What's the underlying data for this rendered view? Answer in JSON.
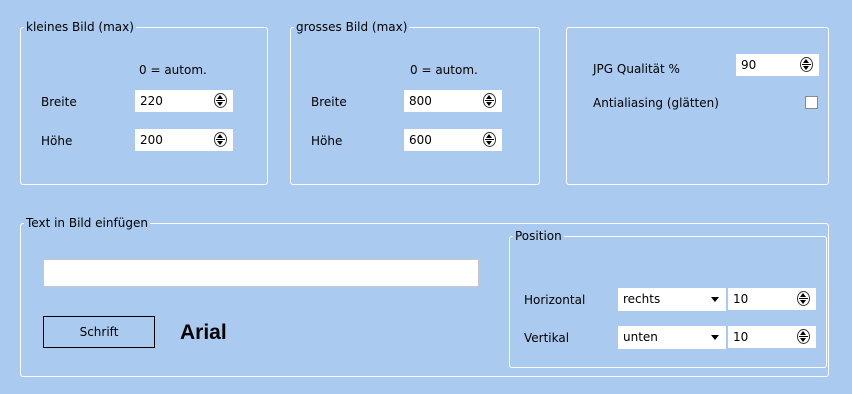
{
  "small_image": {
    "legend": "kleines Bild (max)",
    "hint": "0 = autom.",
    "width_label": "Breite",
    "width_value": "220",
    "height_label": "Höhe",
    "height_value": "200"
  },
  "large_image": {
    "legend": "grosses Bild (max)",
    "hint": "0 = autom.",
    "width_label": "Breite",
    "width_value": "800",
    "height_label": "Höhe",
    "height_value": "600"
  },
  "quality": {
    "jpg_label": "JPG Qualität %",
    "jpg_value": "90",
    "antialias_label": "Antialiasing (glätten)",
    "antialias_checked": false
  },
  "text_insert": {
    "legend": "Text in Bild einfügen",
    "text_value": "",
    "font_button": "Schrift",
    "font_name": "Arial"
  },
  "position": {
    "legend": "Position",
    "horizontal_label": "Horizontal",
    "horizontal_select": "rechts",
    "horizontal_value": "10",
    "vertical_label": "Vertikal",
    "vertical_select": "unten",
    "vertical_value": "10"
  },
  "colors": {
    "background": "#aacbef",
    "border": "#ffffff"
  },
  "icons": [
    "spin-up-down-icon",
    "dropdown-arrow-icon",
    "checkbox-icon"
  ]
}
